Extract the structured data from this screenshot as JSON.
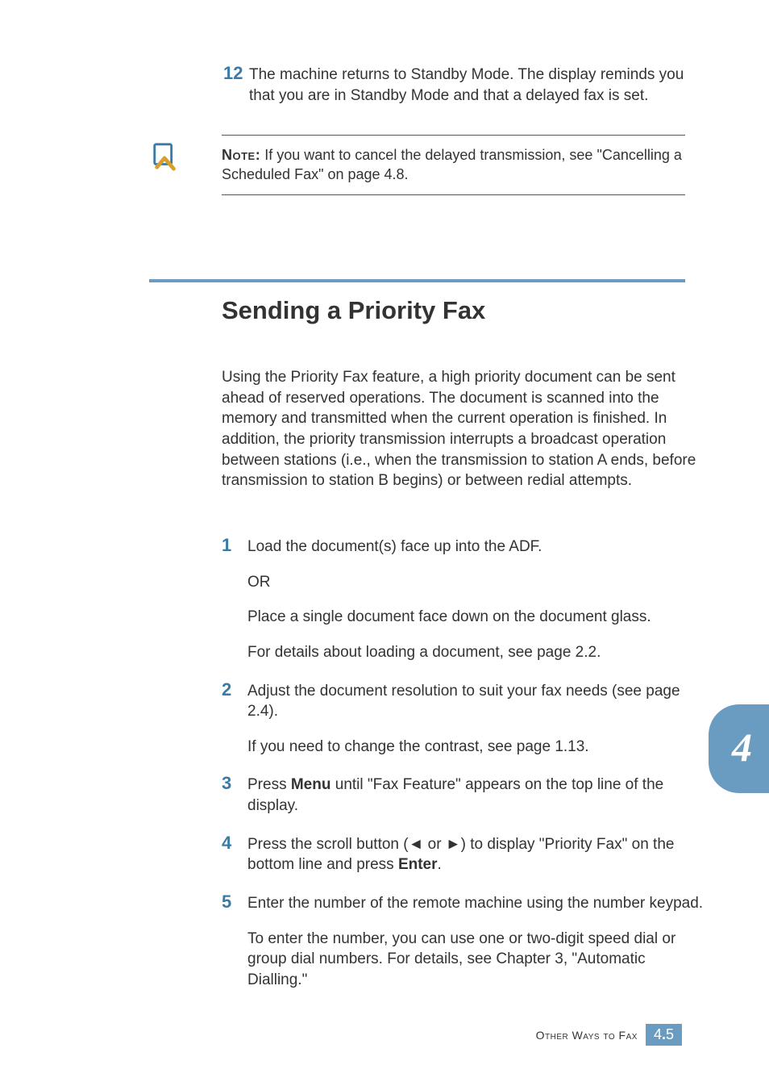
{
  "step12": {
    "num": "12",
    "text": "The machine returns to Standby Mode. The display reminds you that you are in Standby Mode and that a delayed fax is set."
  },
  "note": {
    "label": "Note:",
    "text": " If you want to cancel the delayed transmission, see \"Cancelling a Scheduled Fax\" on page 4.8."
  },
  "section_heading": "Sending a Priority Fax",
  "intro": "Using the Priority Fax feature, a high priority document can be sent ahead of reserved operations. The document is scanned into the memory and transmitted when the current operation is finished. In addition, the priority transmission interrupts a broadcast operation between stations (i.e., when the transmission to station A ends, before transmission to station B begins) or between redial attempts.",
  "steps": [
    {
      "num": "1",
      "paras": [
        "Load the document(s) face up into the ADF.",
        "OR",
        "Place a single document face down on the document glass.",
        "For details about loading a document, see page 2.2."
      ]
    },
    {
      "num": "2",
      "paras": [
        "Adjust the document resolution to suit your fax needs (see page 2.4).",
        "If you need to change the contrast, see page 1.13."
      ]
    },
    {
      "num": "3",
      "pre": "Press ",
      "bold": "Menu",
      "post": " until \"Fax Feature\" appears on the top line of the display."
    },
    {
      "num": "4",
      "pre": "Press the scroll button (◄ or ►) to display \"Priority Fax\" on the bottom line and press ",
      "bold": "Enter",
      "post": "."
    },
    {
      "num": "5",
      "paras": [
        "Enter the number of the remote machine using the number keypad.",
        "To enter the number, you can use one or two-digit speed dial or group dial numbers. For details, see Chapter 3, \"Automatic Dialling.\""
      ]
    }
  ],
  "chapter_tab": "4",
  "footer": {
    "label": "Other Ways to Fax",
    "chapter": "4",
    "dot": ".",
    "page": "5"
  }
}
